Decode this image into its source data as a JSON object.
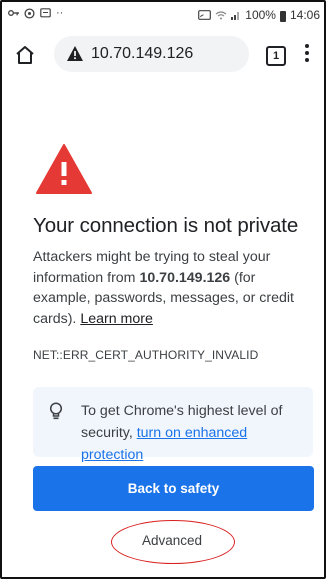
{
  "status_bar": {
    "left_icons": [
      "key-icon",
      "hotspot-icon",
      "message-icon",
      "more-dots-icon"
    ],
    "battery": "100%",
    "time": "14:06"
  },
  "toolbar": {
    "url": "10.70.149.126",
    "tab_count": "1"
  },
  "interstitial": {
    "heading": "Your connection is not private",
    "desc_part1": "Attackers might be trying to steal your information from ",
    "desc_host": "10.70.149.126",
    "desc_part2": " (for example, passwords, messages, or credit cards). ",
    "learn_more": "Learn more",
    "error_code": "NET::ERR_CERT_AUTHORITY_INVALID",
    "tip_prefix": "To get Chrome's highest level of security, ",
    "tip_link": "turn on enhanced protection",
    "back_button": "Back to safety",
    "advanced_button": "Advanced"
  },
  "colors": {
    "primary": "#1a73e8",
    "warning_red": "#e53935",
    "annotation_circle": "#d9201f",
    "tip_bg": "#f1f6fd"
  }
}
